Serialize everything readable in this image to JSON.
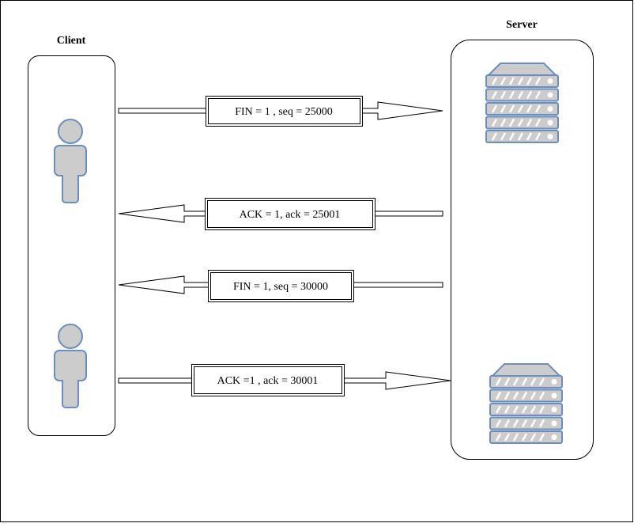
{
  "client": {
    "title": "Client"
  },
  "server": {
    "title": "Server"
  },
  "messages": [
    {
      "label": "FIN = 1 , seq = 25000",
      "direction": "client-to-server"
    },
    {
      "label": "ACK = 1, ack = 25001",
      "direction": "server-to-client"
    },
    {
      "label": "FIN = 1, seq = 30000",
      "direction": "server-to-client"
    },
    {
      "label": "ACK =1 , ack = 30001",
      "direction": "client-to-server"
    }
  ],
  "colors": {
    "icon_fill": "#cccccc",
    "icon_stroke": "#6c8ebf",
    "line": "#000000"
  },
  "icons": {
    "client": "person-icon",
    "server": "server-rack-icon"
  }
}
